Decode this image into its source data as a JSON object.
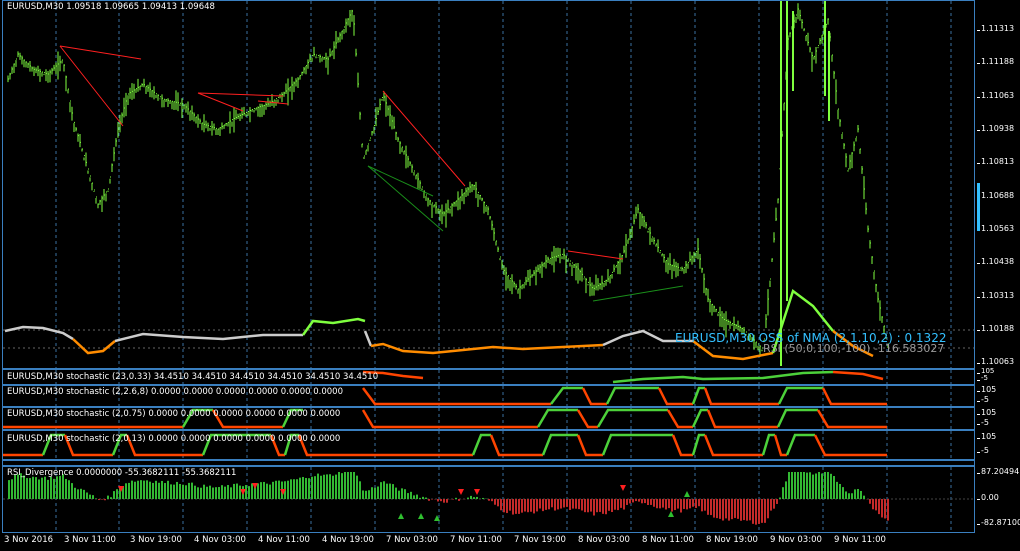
{
  "main_chart": {
    "label": "EURUSD,M30  1.09518 1.09665 1.09413 1.09648",
    "y_ticks": [
      "1.11313",
      "1.11188",
      "1.11063",
      "1.10938",
      "1.10813",
      "1.10688",
      "1.10563",
      "1.10438",
      "1.10313",
      "1.10188",
      "1.10063"
    ],
    "overlay_label_1": "EURUSD,M30 OSS of NMA (2,1.10,2) : 0.1322",
    "overlay_label_2": "RSI (50,0,100,-100) -116.583027"
  },
  "panes": [
    {
      "label": "EURUSD,M30 stochastic (23,0.33) 34.4510 34.4510 34.4510 34.4510 34.4510 34.4510",
      "y_ticks": [
        "105",
        "-5"
      ]
    },
    {
      "label": "EURUSD,M30 stochastic (2,2.6,8) 0.0000 0.0000 0.0000 0.0000 0.0000 0.0000",
      "y_ticks": [
        "105",
        "-5"
      ]
    },
    {
      "label": "EURUSD,M30 stochastic (2,0.75) 0.0000 0.0000 0.0000 0.0000 0.0000 0.0000",
      "y_ticks": [
        "105",
        "-5"
      ]
    },
    {
      "label": "EURUSD,M30 stochastic (2,0.13) 0.0000 0.0000 0.0000 0.0000 0.0000 0.0000",
      "y_ticks": [
        "105",
        "-5"
      ]
    }
  ],
  "rsi_pane": {
    "label": "RSI_Divergence 0.0000000 -55.3682111 -55.3682111",
    "y_ticks": [
      "87.20494",
      "0.00",
      "-82.87100"
    ]
  },
  "x_axis": [
    "3 Nov 2016",
    "3 Nov 11:00",
    "3 Nov 19:00",
    "4 Nov 03:00",
    "4 Nov 11:00",
    "4 Nov 19:00",
    "7 Nov 03:00",
    "7 Nov 11:00",
    "7 Nov 19:00",
    "8 Nov 03:00",
    "8 Nov 11:00",
    "8 Nov 19:00",
    "9 Nov 03:00",
    "9 Nov 11:00"
  ],
  "colors": {
    "candle": "#7fff3f",
    "grid": "#3a6f9f",
    "border": "#3a7fbf",
    "trend": "#ff2020",
    "trend_green": "#1a8f1a",
    "orange": "#ff8c00",
    "stoch_green": "#4cd13a",
    "stoch_red": "#ff4500",
    "label_cyan": "#33c0ff"
  }
}
